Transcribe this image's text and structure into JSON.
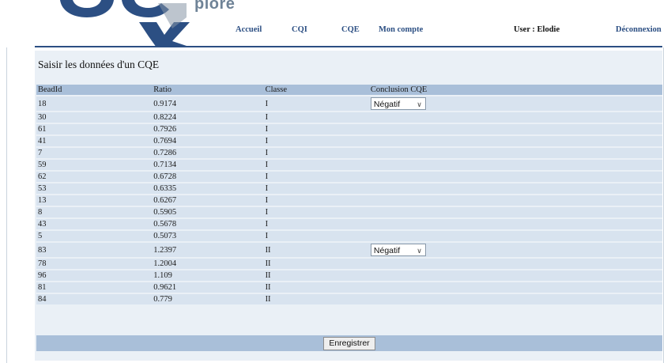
{
  "header": {
    "logo_word": "plore",
    "nav": {
      "accueil": "Accueil",
      "cqi": "CQI",
      "cqe": "CQE",
      "mon_compte": "Mon compte",
      "deconnexion": "Déconnexion"
    },
    "user_label": "User : Elodie"
  },
  "page": {
    "title": "Saisir les données d'un CQE"
  },
  "table": {
    "columns": [
      "BeadId",
      "Ratio",
      "Classe",
      "Conclusion CQE"
    ],
    "rows": [
      {
        "bead": "18",
        "ratio": "0.9174",
        "classe": "I",
        "conclusion": "Négatif"
      },
      {
        "bead": "30",
        "ratio": "0.8224",
        "classe": "I",
        "conclusion": ""
      },
      {
        "bead": "61",
        "ratio": "0.7926",
        "classe": "I",
        "conclusion": ""
      },
      {
        "bead": "41",
        "ratio": "0.7694",
        "classe": "I",
        "conclusion": ""
      },
      {
        "bead": "7",
        "ratio": "0.7286",
        "classe": "I",
        "conclusion": ""
      },
      {
        "bead": "59",
        "ratio": "0.7134",
        "classe": "I",
        "conclusion": ""
      },
      {
        "bead": "62",
        "ratio": "0.6728",
        "classe": "I",
        "conclusion": ""
      },
      {
        "bead": "53",
        "ratio": "0.6335",
        "classe": "I",
        "conclusion": ""
      },
      {
        "bead": "13",
        "ratio": "0.6267",
        "classe": "I",
        "conclusion": ""
      },
      {
        "bead": "8",
        "ratio": "0.5905",
        "classe": "I",
        "conclusion": ""
      },
      {
        "bead": "43",
        "ratio": "0.5678",
        "classe": "I",
        "conclusion": ""
      },
      {
        "bead": "5",
        "ratio": "0.5073",
        "classe": "I",
        "conclusion": ""
      },
      {
        "bead": "83",
        "ratio": "1.2397",
        "classe": "II",
        "conclusion": "Négatif"
      },
      {
        "bead": "78",
        "ratio": "1.2004",
        "classe": "II",
        "conclusion": ""
      },
      {
        "bead": "96",
        "ratio": "1.109",
        "classe": "II",
        "conclusion": ""
      },
      {
        "bead": "81",
        "ratio": "0.9621",
        "classe": "II",
        "conclusion": ""
      },
      {
        "bead": "84",
        "ratio": "0.779",
        "classe": "II",
        "conclusion": ""
      }
    ]
  },
  "save_label": "Enregistrer",
  "colors": {
    "nav_link": "#2c4f83",
    "panel_bg": "#eaf0f6",
    "header_row_bg": "#a9bfd9",
    "row_bg": "#d8e3ef",
    "logo_blue": "#2c4f83"
  },
  "icons": {
    "select_chevron": "chevron-down-icon"
  }
}
